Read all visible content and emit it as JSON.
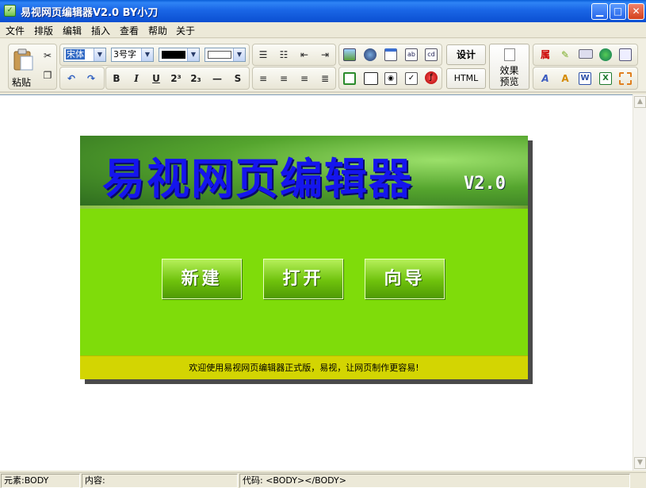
{
  "window": {
    "title": "易视网页编辑器V2.0 BY小刀",
    "minimize_glyph": "▁",
    "maximize_glyph": "□",
    "close_glyph": "✕"
  },
  "menu": [
    "文件",
    "排版",
    "编辑",
    "插入",
    "查看",
    "帮助",
    "关于"
  ],
  "toolbar": {
    "paste_label": "粘贴",
    "cut_icon": "scissors-icon",
    "copy_icon": "copy-icon",
    "undo_icon": "undo-icon",
    "redo_icon": "redo-icon",
    "font_family": "宋体",
    "font_size": "3号字",
    "fore_color": "#000000",
    "back_color": "#ffffff",
    "bold": "B",
    "italic": "I",
    "underline": "U",
    "superscript": "2³",
    "subscript": "2₃",
    "hr": "—",
    "strike": "S",
    "design_label": "设计",
    "html_label": "HTML",
    "preview_line1": "效果",
    "preview_line2": "预览",
    "attr_label": "属"
  },
  "banner": {
    "title": "易视网页编辑器",
    "version": "V2.0",
    "buttons": [
      "新建",
      "打开",
      "向导"
    ],
    "footer": "欢迎使用易视网页编辑器正式版，易视，让网页制作更容易!"
  },
  "status": {
    "element": "元素:BODY",
    "content": "内容:",
    "code": "代码:  <BODY></BODY>"
  },
  "colors": {
    "banner_green": "#7fdc0a",
    "title_blue": "#1515ee",
    "footer_yellow": "#d3d502"
  }
}
